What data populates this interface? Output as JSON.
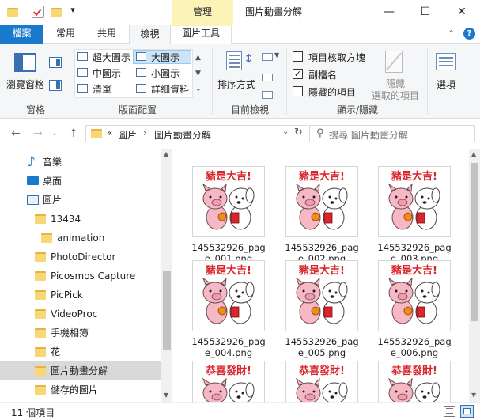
{
  "titlebar": {
    "manage_tab": "管理",
    "title": "圖片動畫分解",
    "quick_access_dropdown": "▾",
    "minimize": "—",
    "maximize": "☐",
    "close": "✕"
  },
  "tabs": [
    {
      "label": "檔案"
    },
    {
      "label": "常用"
    },
    {
      "label": "共用"
    },
    {
      "label": "檢視"
    },
    {
      "label": "圖片工具"
    }
  ],
  "ribbon": {
    "pane_button": "瀏覽窗格",
    "group_pane": "窗格",
    "layout_options": [
      {
        "label": "超大圖示",
        "selected": false
      },
      {
        "label": "大圖示",
        "selected": true
      },
      {
        "label": "中圖示",
        "selected": false
      },
      {
        "label": "小圖示",
        "selected": false
      },
      {
        "label": "清單",
        "selected": false
      },
      {
        "label": "詳細資料",
        "selected": false
      }
    ],
    "group_layout": "版面配置",
    "sort_button": "排序方式",
    "group_current_view": "目前檢視",
    "item_checkboxes": {
      "label": "項目核取方塊",
      "checked": false
    },
    "file_extensions": {
      "label": "副檔名",
      "checked": true
    },
    "hidden_items": {
      "label": "隱藏的項目",
      "checked": false
    },
    "hide_selected_line1": "隱藏",
    "hide_selected_line2": "選取的項目",
    "group_show_hide": "顯示/隱藏",
    "options_button": "選項"
  },
  "address": {
    "prefix": "«",
    "crumb1": "圖片",
    "sep": "›",
    "crumb2": "圖片動畫分解",
    "search_placeholder": "搜尋 圖片動畫分解"
  },
  "nav_items": [
    {
      "label": "音樂",
      "icon": "music-icon"
    },
    {
      "label": "桌面",
      "icon": "desktop-icon"
    },
    {
      "label": "圖片",
      "icon": "pictures-icon"
    },
    {
      "label": "13434",
      "icon": "folder-icon"
    },
    {
      "label": "animation",
      "icon": "folder-icon"
    },
    {
      "label": "PhotoDirector",
      "icon": "folder-icon"
    },
    {
      "label": "Picosmos Capture",
      "icon": "folder-icon"
    },
    {
      "label": "PicPick",
      "icon": "folder-icon"
    },
    {
      "label": "VideoProc",
      "icon": "folder-icon"
    },
    {
      "label": "手機相簿",
      "icon": "folder-icon"
    },
    {
      "label": "花",
      "icon": "folder-icon"
    },
    {
      "label": "圖片動畫分解",
      "icon": "folder-icon",
      "selected": true
    },
    {
      "label": "儲存的圖片",
      "icon": "folder-icon"
    }
  ],
  "files": [
    {
      "name": "145532926_page_001.png",
      "greeting": "豬是大吉!"
    },
    {
      "name": "145532926_page_002.png",
      "greeting": "豬是大吉!"
    },
    {
      "name": "145532926_page_003.png",
      "greeting": "豬是大吉!"
    },
    {
      "name": "145532926_page_004.png",
      "greeting": "豬是大吉!"
    },
    {
      "name": "145532926_page_005.png",
      "greeting": "豬是大吉!"
    },
    {
      "name": "145532926_page_006.png",
      "greeting": "豬是大吉!"
    },
    {
      "name": "",
      "greeting": "恭喜發財!"
    },
    {
      "name": "",
      "greeting": "恭喜發財!"
    },
    {
      "name": "",
      "greeting": "恭喜發財!"
    }
  ],
  "status": {
    "item_count": "11 個項目"
  },
  "colors": {
    "file_tab": "#1979ca",
    "manage_tab": "#fcf3b6",
    "greeting_red": "#d8262c",
    "pig_pink": "#f6b8c4",
    "selected_bg": "#d9d9d9"
  }
}
